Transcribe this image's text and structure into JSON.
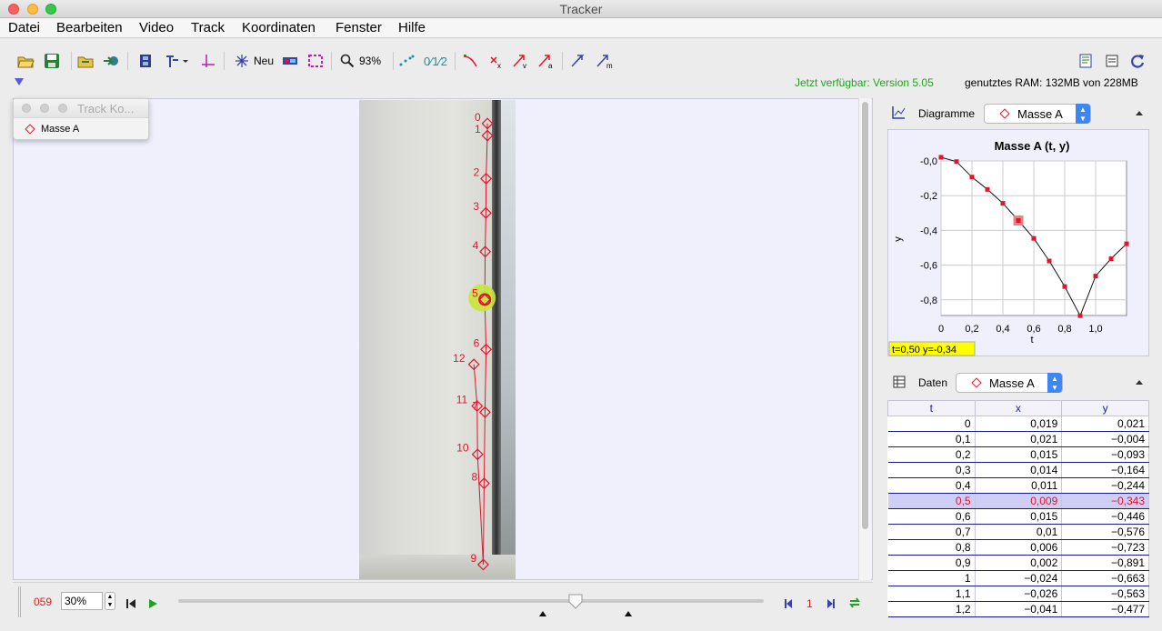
{
  "window": {
    "title": "Tracker"
  },
  "menu": [
    "Datei",
    "Bearbeiten",
    "Video",
    "Track",
    "Koordinaten",
    "Fenster",
    "Hilfe"
  ],
  "toolbar": {
    "new_label": "Neu",
    "zoom_label": "93%",
    "subscript_label": "0⁄1⁄2"
  },
  "status": {
    "available": "Jetzt verfügbar: Version 5.05",
    "ram": "genutztes RAM: 132MB von 228MB"
  },
  "track_popup": {
    "title": "Track Ko...",
    "item": "Masse A"
  },
  "player": {
    "frame": "059",
    "rate": "30%",
    "step": "1"
  },
  "diagram_panel": {
    "label": "Diagramme",
    "track": "Masse A"
  },
  "data_panel": {
    "label": "Daten",
    "track": "Masse A"
  },
  "chart_data": {
    "type": "scatter",
    "title": "Masse A (t, y)",
    "xlabel": "t",
    "ylabel": "y",
    "x_ticks": [
      "0",
      "0,2",
      "0,4",
      "0,6",
      "0,8",
      "1,0"
    ],
    "y_ticks": [
      "-0,0",
      "-0,2",
      "-0,4",
      "-0,6",
      "-0,8"
    ],
    "xlim": [
      0,
      1.2
    ],
    "ylim": [
      -0.89,
      0.0
    ],
    "x": [
      0,
      0.1,
      0.2,
      0.3,
      0.4,
      0.5,
      0.6,
      0.7,
      0.8,
      0.9,
      1.0,
      1.1,
      1.2
    ],
    "y": [
      0.021,
      -0.004,
      -0.093,
      -0.164,
      -0.244,
      -0.343,
      -0.446,
      -0.576,
      -0.723,
      -0.891,
      -0.663,
      -0.563,
      -0.477
    ],
    "selected_index": 5,
    "readout": "t=0,50  y=-0,34",
    "grid": true,
    "color": "#e0142b"
  },
  "table": {
    "headers": [
      "t",
      "x",
      "y"
    ],
    "rows": [
      [
        "0",
        "0,019",
        "0,021"
      ],
      [
        "0,1",
        "0,021",
        "−0,004"
      ],
      [
        "0,2",
        "0,015",
        "−0,093"
      ],
      [
        "0,3",
        "0,014",
        "−0,164"
      ],
      [
        "0,4",
        "0,011",
        "−0,244"
      ],
      [
        "0,5",
        "0,009",
        "−0,343"
      ],
      [
        "0,6",
        "0,015",
        "−0,446"
      ],
      [
        "0,7",
        "0,01",
        "−0,576"
      ],
      [
        "0,8",
        "0,006",
        "−0,723"
      ],
      [
        "0,9",
        "0,002",
        "−0,891"
      ],
      [
        "1",
        "−0,024",
        "−0,663"
      ],
      [
        "1,1",
        "−0,026",
        "−0,563"
      ],
      [
        "1,2",
        "−0,041",
        "−0,477"
      ]
    ],
    "selected_row": 5
  },
  "video_track": {
    "points": [
      {
        "label": "0",
        "x": 0.021,
        "y": 0.021
      },
      {
        "label": "1",
        "x": 0.021,
        "y": -0.004
      },
      {
        "label": "2",
        "x": 0.015,
        "y": -0.093
      },
      {
        "label": "3",
        "x": 0.014,
        "y": -0.164
      },
      {
        "label": "4",
        "x": 0.011,
        "y": -0.244
      },
      {
        "label": "5",
        "x": 0.009,
        "y": -0.343
      },
      {
        "label": "6",
        "x": 0.015,
        "y": -0.446
      },
      {
        "label": "7",
        "x": 0.01,
        "y": -0.576
      },
      {
        "label": "8",
        "x": 0.006,
        "y": -0.723
      },
      {
        "label": "9",
        "x": 0.002,
        "y": -0.891
      },
      {
        "label": "10",
        "x": -0.024,
        "y": -0.663
      },
      {
        "label": "11",
        "x": -0.026,
        "y": -0.563
      },
      {
        "label": "12",
        "x": -0.041,
        "y": -0.477
      }
    ]
  }
}
